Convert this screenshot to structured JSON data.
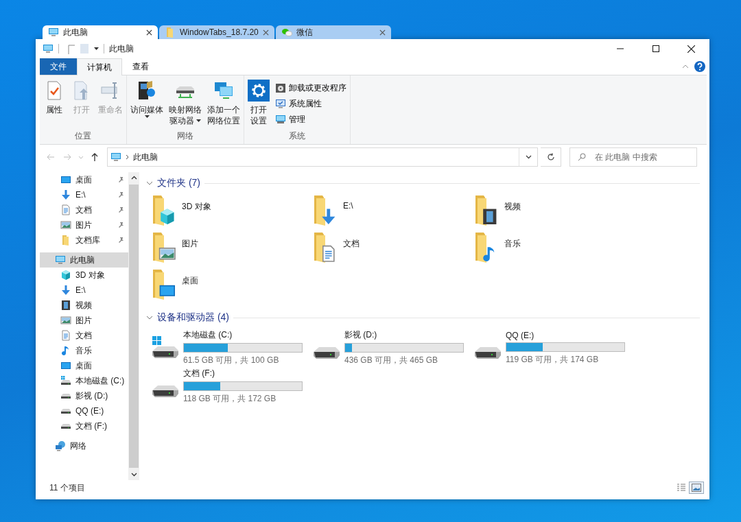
{
  "window_tabs": [
    {
      "label": "此电脑",
      "kind": "pc",
      "selected": true
    },
    {
      "label": "WindowTabs_18.7.20",
      "kind": "folder",
      "selected": false
    },
    {
      "label": "微信",
      "kind": "chat",
      "selected": false
    }
  ],
  "window": {
    "title": "此电脑"
  },
  "ribbon": {
    "tabs": [
      {
        "label": "文件",
        "kind": "file",
        "selected": false
      },
      {
        "label": "计算机",
        "kind": "tab",
        "selected": true
      },
      {
        "label": "查看",
        "kind": "tab",
        "selected": false
      }
    ],
    "groups": [
      {
        "label": "位置",
        "buttons": [
          {
            "lines": [
              "属性"
            ],
            "kind": "properties",
            "disabled": false,
            "dropdown": false
          },
          {
            "lines": [
              "打开"
            ],
            "kind": "open",
            "disabled": true,
            "dropdown": false
          },
          {
            "lines": [
              "重命名"
            ],
            "kind": "rename",
            "disabled": true,
            "dropdown": false
          }
        ]
      },
      {
        "label": "网络",
        "buttons": [
          {
            "lines": [
              "访问媒体"
            ],
            "kind": "media",
            "disabled": false,
            "dropdown": true
          },
          {
            "lines": [
              "映射网络",
              "驱动器"
            ],
            "kind": "mapdrive",
            "disabled": false,
            "dropdown": true
          },
          {
            "lines": [
              "添加一个",
              "网络位置"
            ],
            "kind": "addloc",
            "disabled": false,
            "dropdown": false
          }
        ]
      },
      {
        "label": "系统",
        "buttons": [
          {
            "lines": [
              "打开",
              "设置"
            ],
            "kind": "settings",
            "disabled": false,
            "dropdown": false
          }
        ],
        "small_buttons": [
          {
            "label": "卸载或更改程序",
            "kind": "program"
          },
          {
            "label": "系统属性",
            "kind": "sysprops"
          },
          {
            "label": "管理",
            "kind": "manage"
          }
        ]
      }
    ]
  },
  "address": {
    "path": "此电脑"
  },
  "search": {
    "placeholder": "在 此电脑 中搜索"
  },
  "nav": {
    "quick_access": [
      {
        "label": "桌面",
        "kind": "desktop",
        "pinned": true,
        "selected": false
      },
      {
        "label": "E:\\",
        "kind": "download",
        "pinned": true,
        "selected": false
      },
      {
        "label": "文档",
        "kind": "doc",
        "pinned": true,
        "selected": false
      },
      {
        "label": "图片",
        "kind": "picture",
        "pinned": true,
        "selected": false
      },
      {
        "label": "文档库",
        "kind": "folder",
        "pinned": true,
        "selected": false
      }
    ],
    "items": [
      {
        "label": "此电脑",
        "kind": "pc",
        "selected": true,
        "children": [
          {
            "label": "3D 对象",
            "kind": "cube",
            "selected": false
          },
          {
            "label": "E:\\",
            "kind": "download",
            "selected": false
          },
          {
            "label": "视频",
            "kind": "video",
            "selected": false
          },
          {
            "label": "图片",
            "kind": "picture",
            "selected": false
          },
          {
            "label": "文档",
            "kind": "doc",
            "selected": false
          },
          {
            "label": "音乐",
            "kind": "music",
            "selected": false
          },
          {
            "label": "桌面",
            "kind": "desktop",
            "selected": false
          },
          {
            "label": "本地磁盘 (C:)",
            "kind": "sysdrive",
            "selected": false
          },
          {
            "label": "影视 (D:)",
            "kind": "drive",
            "selected": false
          },
          {
            "label": "QQ (E:)",
            "kind": "drive",
            "selected": false
          },
          {
            "label": "文档 (F:)",
            "kind": "drive",
            "selected": false
          }
        ]
      },
      {
        "label": "网络",
        "kind": "network",
        "selected": false
      }
    ]
  },
  "sections": [
    {
      "title": "文件夹 (7)",
      "kind": "folders",
      "expanded": true,
      "items": [
        {
          "label": "3D 对象",
          "kind": "cube"
        },
        {
          "label": "E:\\",
          "kind": "download"
        },
        {
          "label": "视频",
          "kind": "video"
        },
        {
          "label": "图片",
          "kind": "picture"
        },
        {
          "label": "文档",
          "kind": "doc"
        },
        {
          "label": "音乐",
          "kind": "music"
        },
        {
          "label": "桌面",
          "kind": "desktop"
        }
      ]
    },
    {
      "title": "设备和驱动器 (4)",
      "kind": "drives",
      "expanded": true,
      "items": [
        {
          "label": "本地磁盘 (C:)",
          "kind": "sysdrive",
          "level": 0.37,
          "free": "61.5 GB 可用，共 100 GB"
        },
        {
          "label": "影视 (D:)",
          "kind": "drive",
          "level": 0.06,
          "free": "436 GB 可用，共 465 GB"
        },
        {
          "label": "QQ (E:)",
          "kind": "drive",
          "level": 0.31,
          "free": "119 GB 可用，共 174 GB"
        },
        {
          "label": "文档 (F:)",
          "kind": "drive",
          "level": 0.31,
          "free": "118 GB 可用，共 172 GB"
        }
      ]
    }
  ],
  "status_bar": {
    "item_count": "11 个项目",
    "views": [
      {
        "kind": "details",
        "selected": false
      },
      {
        "kind": "tiles",
        "selected": true
      }
    ]
  }
}
